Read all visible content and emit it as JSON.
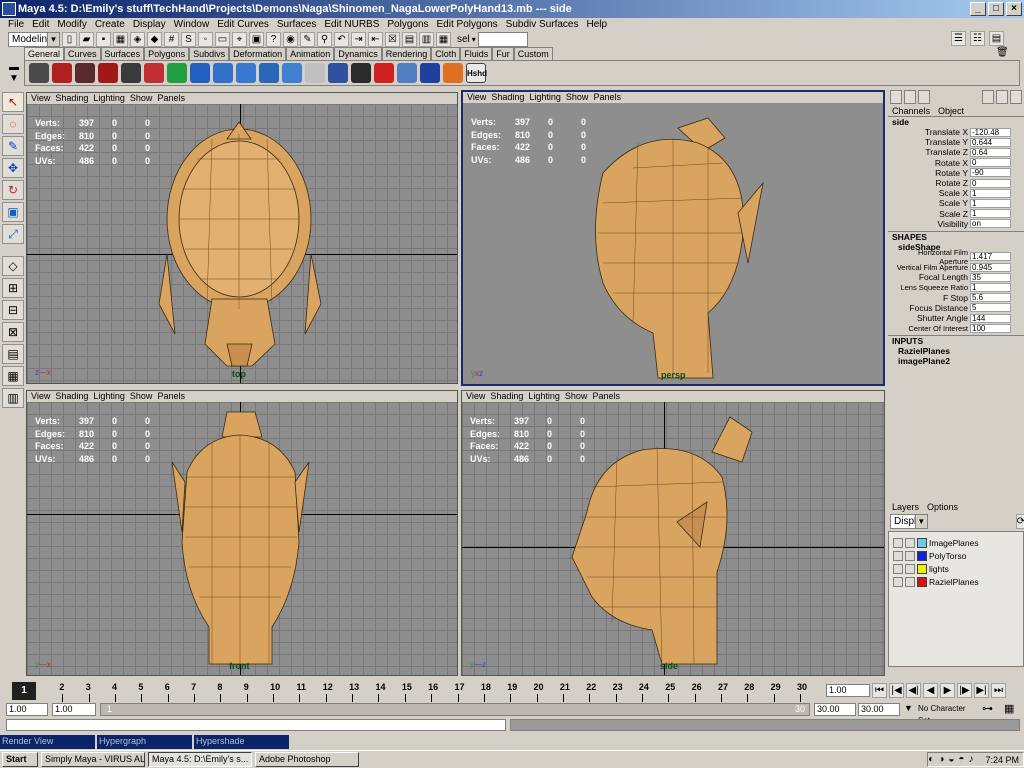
{
  "window": {
    "title": "Maya 4.5: D:\\Emily's stuff\\TechHand\\Projects\\Demons\\Naga\\Shinomen_NagaLowerPolyHand13.mb  ---  side",
    "min": "_",
    "max": "□",
    "close": "×"
  },
  "menu": [
    "File",
    "Edit",
    "Modify",
    "Create",
    "Display",
    "Window",
    "Edit Curves",
    "Surfaces",
    "Edit NURBS",
    "Polygons",
    "Edit Polygons",
    "Subdiv Surfaces",
    "Help"
  ],
  "toolbar": {
    "mode": "Modeling",
    "sel_label": "sel"
  },
  "shelf_tabs": [
    "General",
    "Curves",
    "Surfaces",
    "Polygons",
    "Subdivs",
    "Deformation",
    "Animation",
    "Dynamics",
    "Rendering",
    "Cloth",
    "Fluids",
    "Fur",
    "Custom"
  ],
  "shelf_last_label": "Hshd",
  "viewport_menu": [
    "View",
    "Shading",
    "Lighting",
    "Show",
    "Panels"
  ],
  "hud": {
    "labels": [
      "Verts:",
      "Edges:",
      "Faces:",
      "UVs:"
    ],
    "v1": [
      "397",
      "810",
      "422",
      "486"
    ],
    "v2": [
      "0",
      "0",
      "0",
      "0"
    ],
    "v3": [
      "0",
      "0",
      "0",
      "0"
    ]
  },
  "viewports": {
    "top": "top",
    "persp": "persp",
    "front": "front",
    "side": "side"
  },
  "channel_box": {
    "menu": [
      "Channels",
      "Object"
    ],
    "object": "side",
    "channels": [
      {
        "name": "Translate X",
        "value": "-120.48"
      },
      {
        "name": "Translate Y",
        "value": "0.644"
      },
      {
        "name": "Translate Z",
        "value": "0.64"
      },
      {
        "name": "Rotate X",
        "value": "0"
      },
      {
        "name": "Rotate Y",
        "value": "-90"
      },
      {
        "name": "Rotate Z",
        "value": "0"
      },
      {
        "name": "Scale X",
        "value": "1"
      },
      {
        "name": "Scale Y",
        "value": "1"
      },
      {
        "name": "Scale Z",
        "value": "1"
      },
      {
        "name": "Visibility",
        "value": "on"
      }
    ],
    "shapes_header": "SHAPES",
    "shape_name": "sideShape",
    "shape_channels": [
      {
        "name": "Horizontal Film Aperture",
        "value": "1.417"
      },
      {
        "name": "Vertical Film Aperture",
        "value": "0.945"
      },
      {
        "name": "Focal Length",
        "value": "35"
      },
      {
        "name": "Lens Squeeze Ratio",
        "value": "1"
      },
      {
        "name": "F Stop",
        "value": "5.6"
      },
      {
        "name": "Focus Distance",
        "value": "5"
      },
      {
        "name": "Shutter Angle",
        "value": "144"
      },
      {
        "name": "Center Of Interest",
        "value": "100"
      }
    ],
    "inputs_header": "INPUTS",
    "inputs": [
      "RazielPlanes",
      "imagePlane2"
    ]
  },
  "layers": {
    "menu": [
      "Layers",
      "Options"
    ],
    "display": "Display",
    "items": [
      {
        "name": "ImagePlanes",
        "color": "#6ec8e8"
      },
      {
        "name": "PolyTorso",
        "color": "#1020d8"
      },
      {
        "name": "lights",
        "color": "#f0f000"
      },
      {
        "name": "RazielPlanes",
        "color": "#e01010"
      }
    ]
  },
  "timeline": {
    "ticks": [
      "1",
      "2",
      "3",
      "4",
      "5",
      "6",
      "7",
      "8",
      "9",
      "10",
      "11",
      "12",
      "13",
      "14",
      "15",
      "16",
      "17",
      "18",
      "19",
      "20",
      "21",
      "22",
      "23",
      "24",
      "25",
      "26",
      "27",
      "28",
      "29",
      "30"
    ],
    "current": "1.00"
  },
  "range": {
    "start": "1.00",
    "start2": "1.00",
    "slider_start": "1",
    "slider_end": "30",
    "end": "30.00",
    "end2": "30.00",
    "charset": "No Character Set"
  },
  "minimized": [
    "Render View",
    "Hypergraph",
    "Hypershade"
  ],
  "taskbar": {
    "start": "Start",
    "items": [
      "Simply Maya - VIRUS ALE...",
      "Maya 4.5: D:\\Emily's s...",
      "Adobe Photoshop"
    ],
    "clock": "7:24 PM"
  }
}
